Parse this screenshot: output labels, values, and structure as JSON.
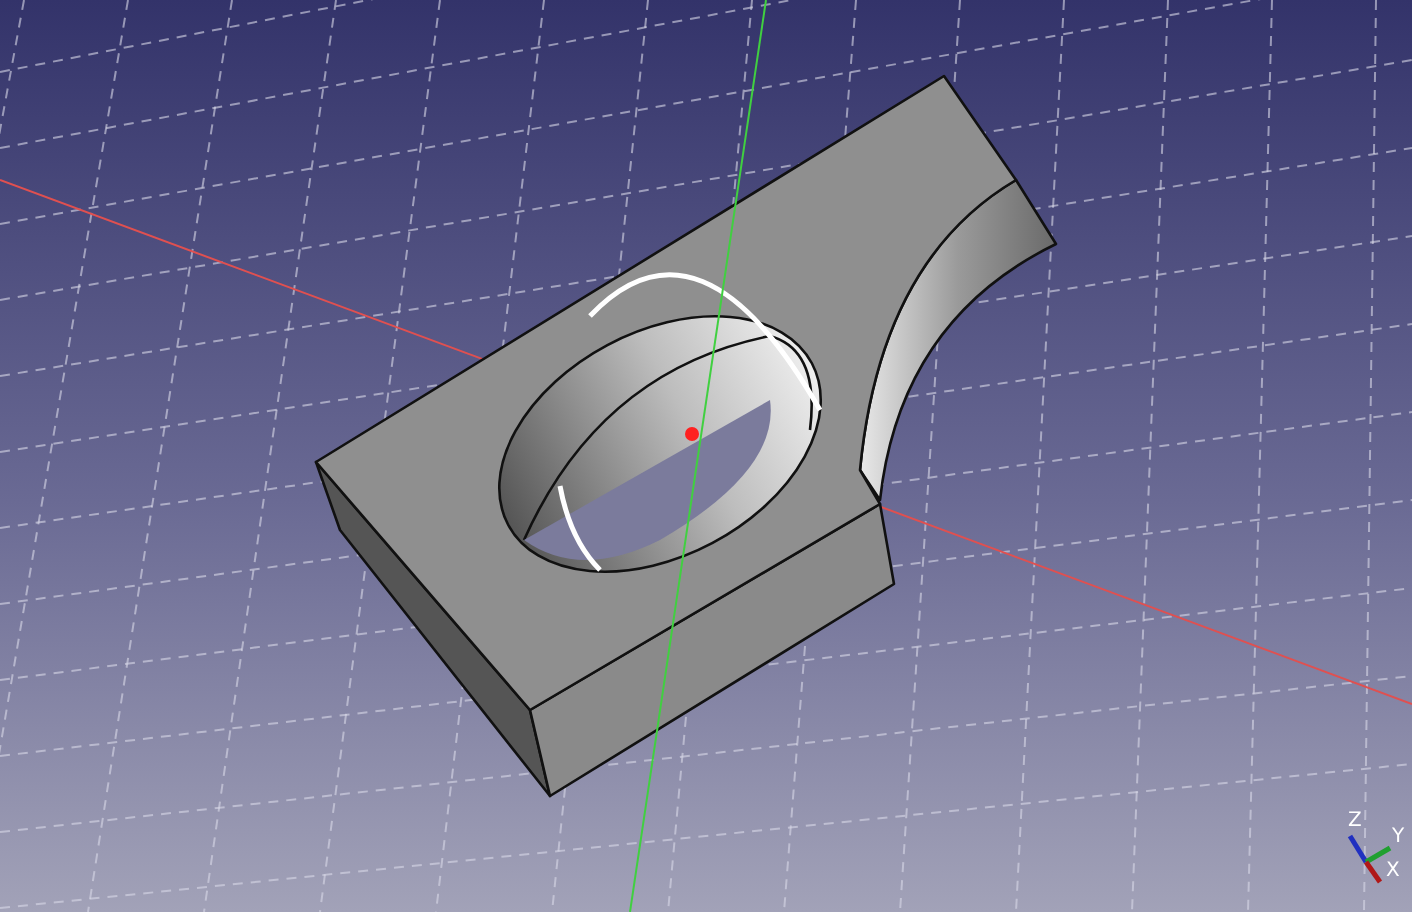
{
  "axis_triad": {
    "labels": [
      "Z",
      "Y",
      "X"
    ]
  }
}
